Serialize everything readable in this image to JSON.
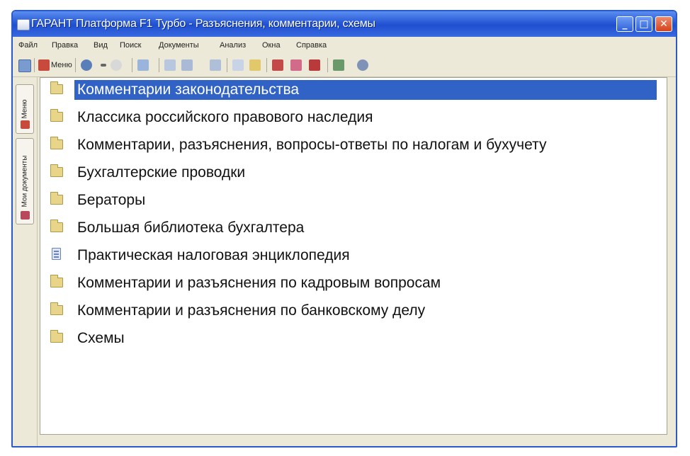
{
  "window": {
    "title": "ГАРАНТ Платформа F1 Турбо - Разъяснения, комментарии, схемы",
    "controls": {
      "minimize": "_",
      "maximize": "□",
      "close": "✕"
    }
  },
  "menubar": {
    "items": [
      "Файл",
      "Правка",
      "Вид",
      "Поиск",
      "Документы",
      "Анализ",
      "Окна",
      "Справка"
    ]
  },
  "toolbar": {
    "menu_label": "Меню",
    "icons": [
      "menu-icon",
      "back-icon",
      "forward-icon",
      "document-list-icon",
      "search-icon",
      "search-list-icon",
      "find-icon",
      "font-size-icon",
      "font-color-icon",
      "bookmark-red-icon",
      "bookmark-pink-icon",
      "bookmark-red-2-icon",
      "export-icon",
      "history-icon"
    ]
  },
  "sidebar": {
    "tabs": [
      "Меню",
      "Мои документы"
    ]
  },
  "tree": {
    "items": [
      {
        "label": "Комментарии законодательства",
        "icon": "folder-icon",
        "selected": true
      },
      {
        "label": "Классика российского правового наследия",
        "icon": "folder-icon"
      },
      {
        "label": "Комментарии, разъяснения, вопросы-ответы по налогам и бухучету",
        "icon": "folder-icon"
      },
      {
        "label": "Бухгалтерские проводки",
        "icon": "folder-icon"
      },
      {
        "label": "Бераторы",
        "icon": "folder-icon"
      },
      {
        "label": "Большая библиотека бухгалтера",
        "icon": "folder-icon"
      },
      {
        "label": "Практическая налоговая энциклопедия",
        "icon": "document-icon"
      },
      {
        "label": "Комментарии и разъяснения по кадровым вопросам",
        "icon": "folder-icon"
      },
      {
        "label": "Комментарии и разъяснения по банковскому делу",
        "icon": "folder-icon"
      },
      {
        "label": "Схемы",
        "icon": "folder-icon"
      }
    ]
  },
  "colors": {
    "titlebar": "#2758d6",
    "selection": "#3162c6",
    "window_bg": "#ece9d8"
  }
}
